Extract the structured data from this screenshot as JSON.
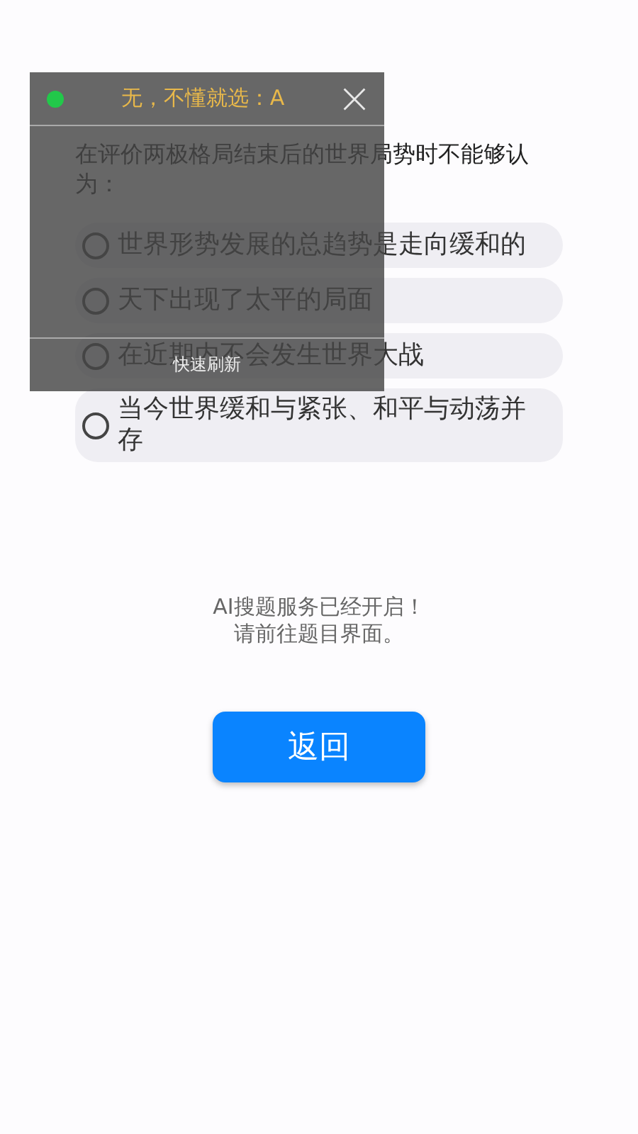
{
  "question": {
    "text": "在评价两极格局结束后的世界局势时不能够认为：",
    "options": [
      {
        "text": "世界形势发展的总趋势是走向缓和的",
        "selected": false
      },
      {
        "text": "天下出现了太平的局面",
        "selected": false
      },
      {
        "text": "在近期内不会发生世界大战",
        "selected": false
      },
      {
        "text": "当今世界缓和与紧张、和平与动荡并存",
        "selected": false
      }
    ]
  },
  "message": {
    "lines": [
      "AI搜题服务已经开启！",
      "请前往题目界面。"
    ]
  },
  "back_button": {
    "label": "返回"
  },
  "overlay": {
    "answer": "无，不懂就选：A",
    "refresh": "快速刷新"
  }
}
